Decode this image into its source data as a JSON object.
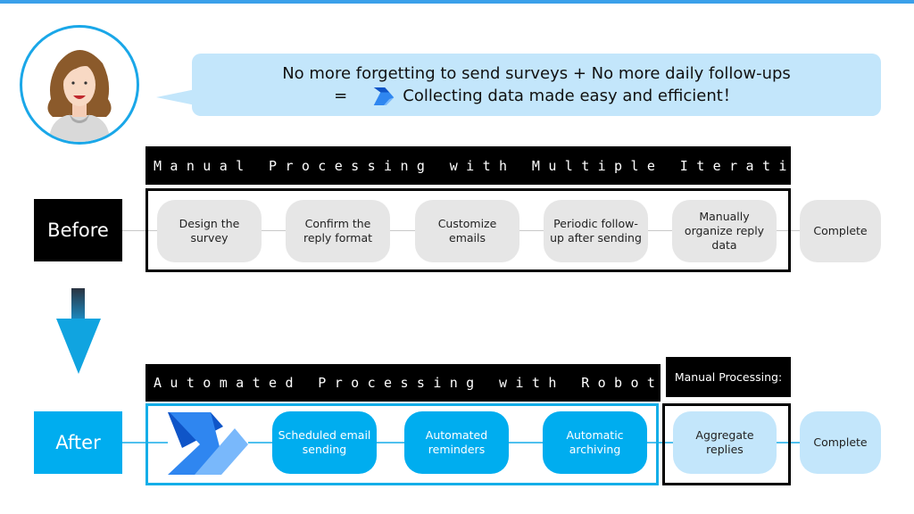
{
  "speech_bubble": {
    "line1": "No more forgetting to send surveys + No more daily follow-ups",
    "equals": "=",
    "line2": "Collecting data made easy and efficient！"
  },
  "before": {
    "label": "Before",
    "header": "Manual Processing with Multiple Iterations:",
    "steps": [
      "Design the survey",
      "Confirm the reply format",
      "Customize emails",
      "Periodic follow-up after sending",
      "Manually organize reply data"
    ],
    "complete": "Complete"
  },
  "after": {
    "label": "After",
    "header": "Automated Processing with Robots:",
    "manual_header": "Manual Processing:",
    "steps": [
      "Scheduled email sending",
      "Automated reminders",
      "Automatic archiving"
    ],
    "manual_step": "Aggregate replies",
    "complete": "Complete"
  },
  "colors": {
    "accent_blue": "#00adef",
    "light_blue": "#c3e6fb",
    "gray_step": "#e6e6e6",
    "black": "#000000"
  },
  "icons": {
    "avatar": "woman-avatar-icon",
    "logo": "power-automate-logo-icon",
    "arrow": "down-arrow-icon"
  }
}
